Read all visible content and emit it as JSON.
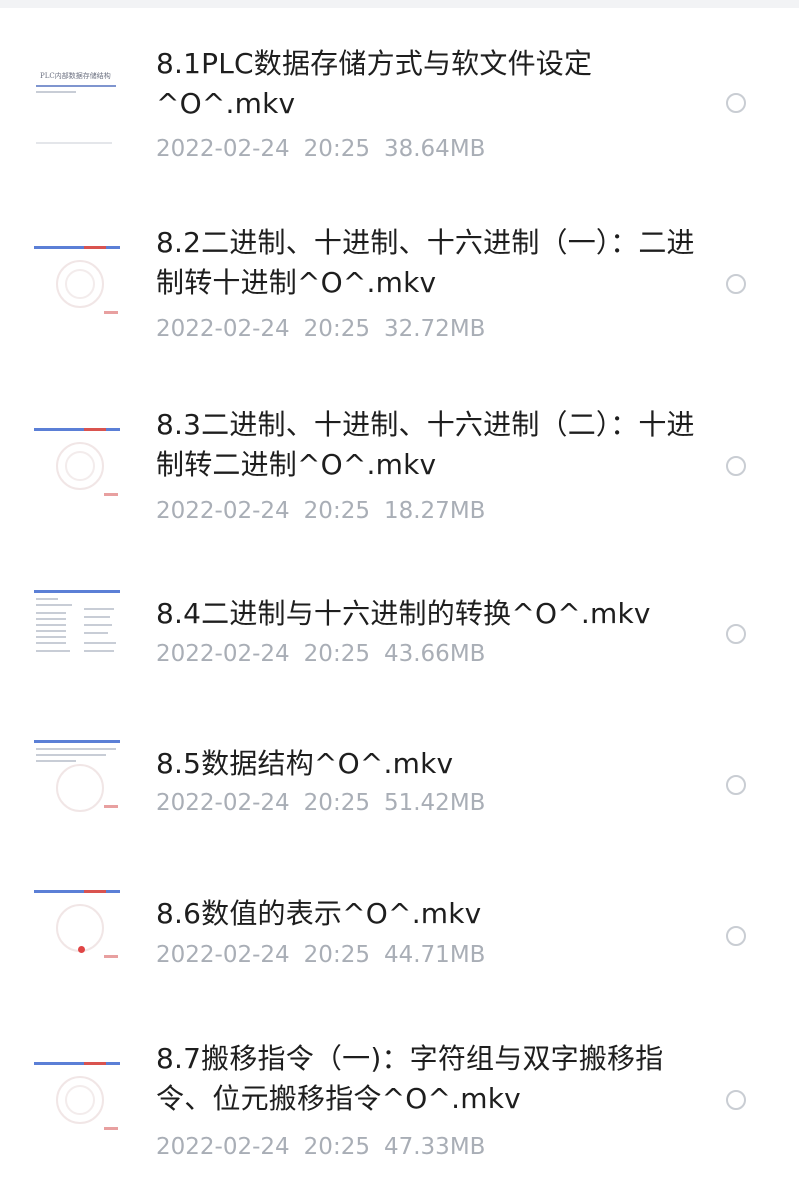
{
  "files": [
    {
      "title": "8.1PLC数据存储方式与软文件设定^O^.mkv",
      "date": "2022-02-24",
      "time": "20:25",
      "size": "38.64MB",
      "thumb": "title-slide",
      "thumb_text": "PLC内部数据存储结构"
    },
    {
      "title": "8.2二进制、十进制、十六进制（一）：二进制转十进制^O^.mkv",
      "date": "2022-02-24",
      "time": "20:25",
      "size": "32.72MB",
      "thumb": "watermark-slide"
    },
    {
      "title": "8.3二进制、十进制、十六进制（二）：十进制转二进制^O^.mkv",
      "date": "2022-02-24",
      "time": "20:25",
      "size": "18.27MB",
      "thumb": "watermark-slide"
    },
    {
      "title": "8.4二进制与十六进制的转换^O^.mkv",
      "date": "2022-02-24",
      "time": "20:25",
      "size": "43.66MB",
      "thumb": "table-slide"
    },
    {
      "title": "8.5数据结构^O^.mkv",
      "date": "2022-02-24",
      "time": "20:25",
      "size": "51.42MB",
      "thumb": "text-slide"
    },
    {
      "title": "8.6数值的表示^O^.mkv",
      "date": "2022-02-24",
      "time": "20:25",
      "size": "44.71MB",
      "thumb": "dot-slide"
    },
    {
      "title": "8.7搬移指令（一)：字符组与双字搬移指令、位元搬移指令^O^.mkv",
      "date": "2022-02-24",
      "time": "20:25",
      "size": "47.33MB",
      "thumb": "watermark-slide"
    }
  ],
  "colors": {
    "title": "#1e1e1e",
    "meta": "#a9aeb6",
    "radio_border": "#c9cdd3",
    "thumb_accent": "#5b7fd6"
  }
}
